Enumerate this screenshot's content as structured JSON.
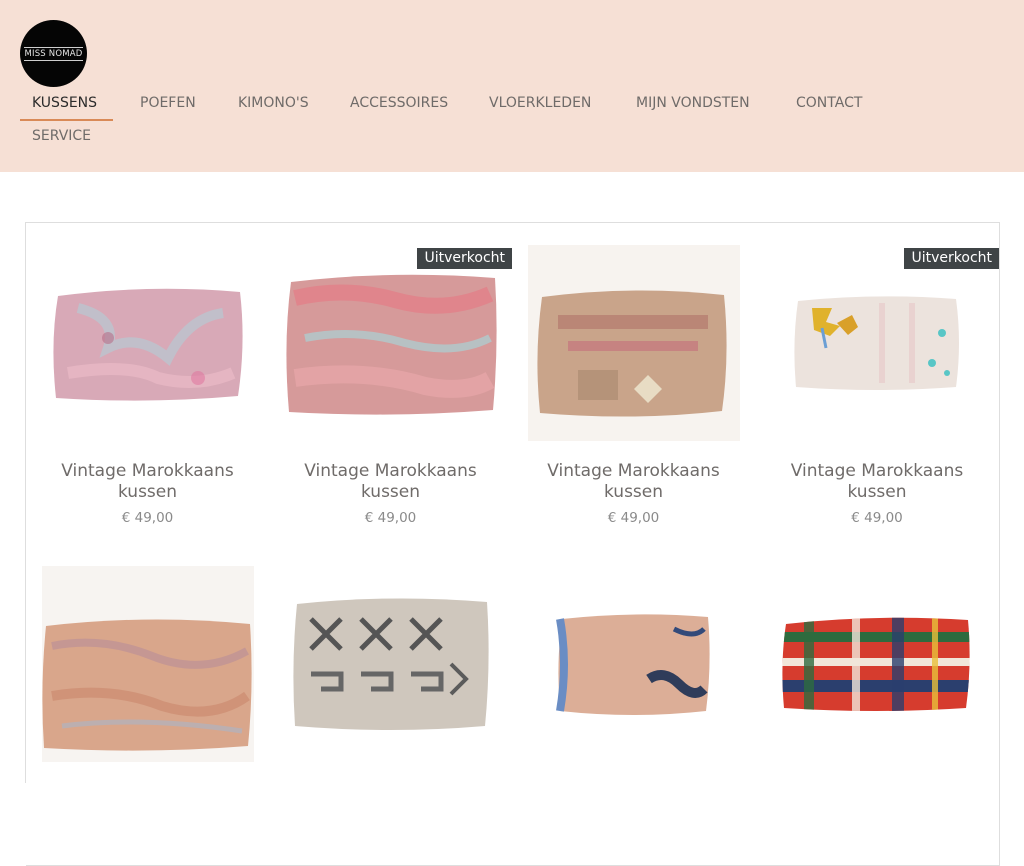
{
  "brand": {
    "logo_text": "MISS NOMAD"
  },
  "nav": {
    "items": [
      {
        "label": "KUSSENS",
        "active": true
      },
      {
        "label": "POEFEN"
      },
      {
        "label": "KIMONO'S"
      },
      {
        "label": "ACCESSOIRES"
      },
      {
        "label": "VLOERKLEDEN"
      },
      {
        "label": "MIJN VONDSTEN"
      },
      {
        "label": "CONTACT"
      },
      {
        "label": "SERVICE"
      }
    ]
  },
  "colors": {
    "header_bg": "#f6e0d5",
    "active_underline": "#d98a57",
    "badge_bg": "#3f4446"
  },
  "products": [
    {
      "title": "Vintage Marokkaans kussen",
      "price": "€ 49,00",
      "badge": "",
      "image": "pink-shag-cushion"
    },
    {
      "title": "Vintage Marokkaans kussen",
      "price": "€ 49,00",
      "badge": "Uitverkocht",
      "image": "red-shag-cushion"
    },
    {
      "title": "Vintage Marokkaans kussen",
      "price": "€ 49,00",
      "badge": "",
      "image": "kilim-pattern-cushion"
    },
    {
      "title": "Vintage Marokkaans kussen",
      "price": "€ 49,00",
      "badge": "Uitverkocht",
      "image": "embroidered-cushion"
    },
    {
      "image": "fringe-shag-cushion"
    },
    {
      "image": "grey-pattern-cushion"
    },
    {
      "image": "peach-shag-cushion"
    },
    {
      "image": "tartan-cushion"
    }
  ]
}
